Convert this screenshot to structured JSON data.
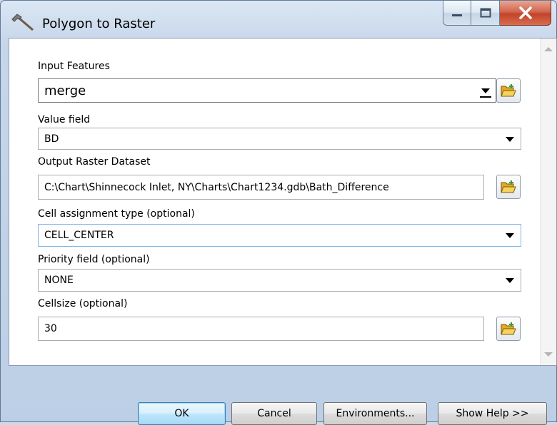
{
  "window": {
    "title": "Polygon to Raster",
    "title_icon": "hammer-icon",
    "controls": [
      "minimize-icon",
      "maximize-icon",
      "close-icon"
    ]
  },
  "form": {
    "input_features": {
      "label": "Input Features",
      "value": "merge"
    },
    "value_field": {
      "label": "Value field",
      "value": "BD"
    },
    "output_raster": {
      "label": "Output Raster Dataset",
      "value": "C:\\Chart\\Shinnecock Inlet, NY\\Charts\\Chart1234.gdb\\Bath_Difference"
    },
    "cell_assignment": {
      "label": "Cell assignment type (optional)",
      "value": "CELL_CENTER"
    },
    "priority_field": {
      "label": "Priority field (optional)",
      "value": "NONE"
    },
    "cellsize": {
      "label": "Cellsize (optional)",
      "value": "30"
    }
  },
  "buttons": {
    "ok": "OK",
    "cancel": "Cancel",
    "environments": "Environments...",
    "show_help": "Show Help >>"
  },
  "colors": {
    "close_button": "#c4432a",
    "default_button": "#bee6fd",
    "folder": "#f0c64a"
  }
}
